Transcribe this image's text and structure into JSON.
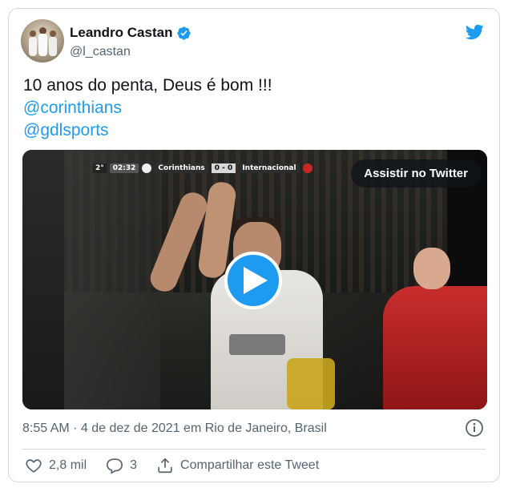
{
  "tweet": {
    "author_name": "Leandro Castan",
    "author_handle": "@l_castan",
    "text_line": "10 anos do penta, Deus é bom !!!",
    "mentions": [
      "@corinthians",
      "@gdlsports"
    ],
    "timestamp": "8:55 AM · 4 de dez de 2021",
    "location_prefix": " em ",
    "location": "Rio de Janeiro, Brasil"
  },
  "video": {
    "watch_label": "Assistir no Twitter",
    "scoreboard": {
      "half": "2°",
      "clock": "02:32",
      "home_team": "Corinthians",
      "score": "0 - 0",
      "away_team": "Internacional"
    }
  },
  "actions": {
    "likes_count": "2,8 mil",
    "replies_count": "3",
    "share_label": "Compartilhar este Tweet"
  },
  "colors": {
    "accent": "#1d9bf0",
    "text_primary": "#0f1419",
    "text_secondary": "#536471",
    "border": "#cfd9de"
  },
  "icons": [
    "verified-badge-icon",
    "twitter-bird-icon",
    "play-icon",
    "info-icon",
    "heart-icon",
    "reply-icon",
    "share-icon"
  ]
}
